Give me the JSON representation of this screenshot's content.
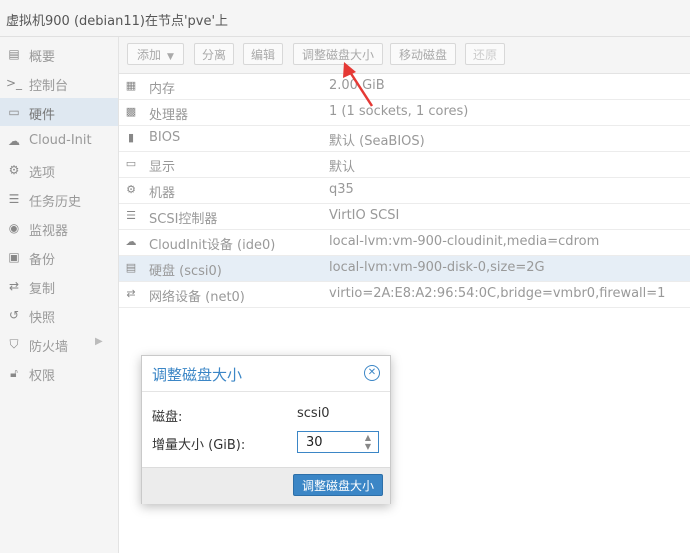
{
  "window": {
    "title": "虚拟机900 (debian11)在节点'pve'上"
  },
  "sidebar": {
    "items": [
      {
        "label": "概要",
        "icon": "book-icon"
      },
      {
        "label": "控制台",
        "icon": "terminal-icon"
      },
      {
        "label": "硬件",
        "icon": "monitor-icon",
        "active": true
      },
      {
        "label": "Cloud-Init",
        "icon": "cloud-icon"
      },
      {
        "label": "选项",
        "icon": "gear-icon"
      },
      {
        "label": "任务历史",
        "icon": "list-icon"
      },
      {
        "label": "监视器",
        "icon": "eye-icon"
      },
      {
        "label": "备份",
        "icon": "floppy-icon"
      },
      {
        "label": "复制",
        "icon": "retweet-icon"
      },
      {
        "label": "快照",
        "icon": "history-icon"
      },
      {
        "label": "防火墙",
        "icon": "shield-icon",
        "has_submenu": true
      },
      {
        "label": "权限",
        "icon": "unlock-icon"
      }
    ]
  },
  "toolbar": {
    "add_label": "添加",
    "detach_label": "分离",
    "edit_label": "编辑",
    "resize_label": "调整磁盘大小",
    "move_label": "移动磁盘",
    "revert_label": "还原"
  },
  "hardware": {
    "rows": [
      {
        "name": "内存",
        "value": "2.00 GiB",
        "icon": "memory-icon"
      },
      {
        "name": "处理器",
        "value": "1 (1 sockets, 1 cores)",
        "icon": "cpu-icon"
      },
      {
        "name": "BIOS",
        "value": "默认 (SeaBIOS)",
        "icon": "microchip-icon"
      },
      {
        "name": "显示",
        "value": "默认",
        "icon": "desktop-icon"
      },
      {
        "name": "机器",
        "value": "q35",
        "icon": "cogs-icon"
      },
      {
        "name": "SCSI控制器",
        "value": "VirtIO SCSI",
        "icon": "database-icon"
      },
      {
        "name": "CloudInit设备 (ide0)",
        "value": "local-lvm:vm-900-cloudinit,media=cdrom",
        "icon": "cloud-icon"
      },
      {
        "name": "硬盘 (scsi0)",
        "value": "local-lvm:vm-900-disk-0,size=2G",
        "icon": "hdd-icon",
        "selected": true
      },
      {
        "name": "网络设备 (net0)",
        "value": "virtio=2A:E8:A2:96:54:0C,bridge=vmbr0,firewall=1",
        "icon": "exchange-icon"
      }
    ]
  },
  "dialog": {
    "title": "调整磁盘大小",
    "disk_label": "磁盘:",
    "disk_value": "scsi0",
    "size_label": "增量大小 (GiB):",
    "size_value": "30",
    "confirm_label": "调整磁盘大小"
  },
  "colors": {
    "accent": "#3b86c6",
    "annotation_arrow": "#e53935"
  }
}
